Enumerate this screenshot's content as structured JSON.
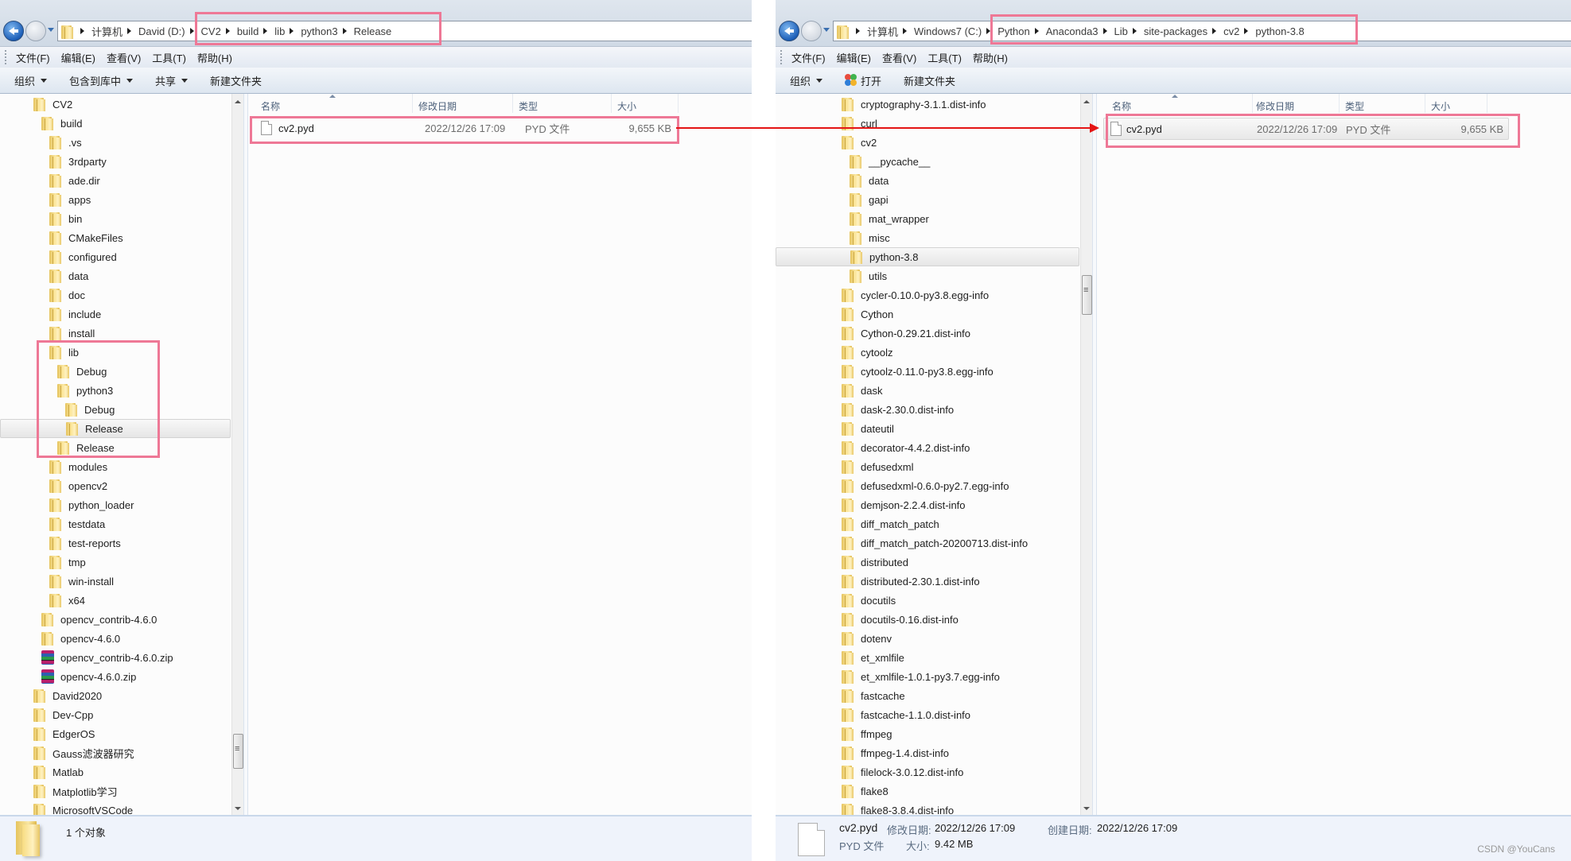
{
  "left_window": {
    "breadcrumb": [
      "计算机",
      "David (D:)",
      "CV2",
      "build",
      "lib",
      "python3",
      "Release"
    ],
    "menu": [
      "文件(F)",
      "编辑(E)",
      "查看(V)",
      "工具(T)",
      "帮助(H)"
    ],
    "toolbar": {
      "organize": "组织",
      "include_in_library": "包含到库中",
      "share": "共享",
      "new_folder": "新建文件夹"
    },
    "tree": [
      {
        "label": "CV2",
        "level": 0,
        "type": "folder"
      },
      {
        "label": "build",
        "level": 1,
        "type": "folder"
      },
      {
        "label": ".vs",
        "level": 2,
        "type": "folder"
      },
      {
        "label": "3rdparty",
        "level": 2,
        "type": "folder"
      },
      {
        "label": "ade.dir",
        "level": 2,
        "type": "folder"
      },
      {
        "label": "apps",
        "level": 2,
        "type": "folder"
      },
      {
        "label": "bin",
        "level": 2,
        "type": "folder"
      },
      {
        "label": "CMakeFiles",
        "level": 2,
        "type": "folder"
      },
      {
        "label": "configured",
        "level": 2,
        "type": "folder"
      },
      {
        "label": "data",
        "level": 2,
        "type": "folder"
      },
      {
        "label": "doc",
        "level": 2,
        "type": "folder"
      },
      {
        "label": "include",
        "level": 2,
        "type": "folder"
      },
      {
        "label": "install",
        "level": 2,
        "type": "folder"
      },
      {
        "label": "lib",
        "level": 2,
        "type": "folder"
      },
      {
        "label": "Debug",
        "level": 3,
        "type": "folder"
      },
      {
        "label": "python3",
        "level": 3,
        "type": "folder"
      },
      {
        "label": "Debug",
        "level": 4,
        "type": "folder"
      },
      {
        "label": "Release",
        "level": 4,
        "type": "folder",
        "selected": true
      },
      {
        "label": "Release",
        "level": 3,
        "type": "folder"
      },
      {
        "label": "modules",
        "level": 2,
        "type": "folder"
      },
      {
        "label": "opencv2",
        "level": 2,
        "type": "folder"
      },
      {
        "label": "python_loader",
        "level": 2,
        "type": "folder"
      },
      {
        "label": "testdata",
        "level": 2,
        "type": "folder"
      },
      {
        "label": "test-reports",
        "level": 2,
        "type": "folder"
      },
      {
        "label": "tmp",
        "level": 2,
        "type": "folder"
      },
      {
        "label": "win-install",
        "level": 2,
        "type": "folder"
      },
      {
        "label": "x64",
        "level": 2,
        "type": "folder"
      },
      {
        "label": "opencv_contrib-4.6.0",
        "level": 1,
        "type": "folder"
      },
      {
        "label": "opencv-4.6.0",
        "level": 1,
        "type": "folder"
      },
      {
        "label": "opencv_contrib-4.6.0.zip",
        "level": 1,
        "type": "zip"
      },
      {
        "label": "opencv-4.6.0.zip",
        "level": 1,
        "type": "zip"
      },
      {
        "label": "David2020",
        "level": 0,
        "type": "folder"
      },
      {
        "label": "Dev-Cpp",
        "level": 0,
        "type": "folder"
      },
      {
        "label": "EdgerOS",
        "level": 0,
        "type": "folder"
      },
      {
        "label": "Gauss滤波器研究",
        "level": 0,
        "type": "folder"
      },
      {
        "label": "Matlab",
        "level": 0,
        "type": "folder"
      },
      {
        "label": "Matplotlib学习",
        "level": 0,
        "type": "folder"
      },
      {
        "label": "MicrosoftVSCode",
        "level": 0,
        "type": "folder"
      }
    ],
    "columns": [
      "名称",
      "修改日期",
      "类型",
      "大小"
    ],
    "files": [
      {
        "name": "cv2.pyd",
        "modified": "2022/12/26 17:09",
        "type": "PYD 文件",
        "size": "9,655 KB"
      }
    ],
    "status": {
      "count_text": "1 个对象"
    }
  },
  "right_window": {
    "breadcrumb": [
      "计算机",
      "Windows7 (C:)",
      "Python",
      "Anaconda3",
      "Lib",
      "site-packages",
      "cv2",
      "python-3.8"
    ],
    "menu": [
      "文件(F)",
      "编辑(E)",
      "查看(V)",
      "工具(T)",
      "帮助(H)"
    ],
    "toolbar": {
      "organize": "组织",
      "open": "打开",
      "new_folder": "新建文件夹"
    },
    "tree": [
      {
        "label": "cryptography-3.1.1.dist-info",
        "level": 0
      },
      {
        "label": "curl",
        "level": 0
      },
      {
        "label": "cv2",
        "level": 0
      },
      {
        "label": "__pycache__",
        "level": 1
      },
      {
        "label": "data",
        "level": 1
      },
      {
        "label": "gapi",
        "level": 1
      },
      {
        "label": "mat_wrapper",
        "level": 1
      },
      {
        "label": "misc",
        "level": 1
      },
      {
        "label": "python-3.8",
        "level": 1,
        "selected": true
      },
      {
        "label": "utils",
        "level": 1
      },
      {
        "label": "cycler-0.10.0-py3.8.egg-info",
        "level": 0
      },
      {
        "label": "Cython",
        "level": 0
      },
      {
        "label": "Cython-0.29.21.dist-info",
        "level": 0
      },
      {
        "label": "cytoolz",
        "level": 0
      },
      {
        "label": "cytoolz-0.11.0-py3.8.egg-info",
        "level": 0
      },
      {
        "label": "dask",
        "level": 0
      },
      {
        "label": "dask-2.30.0.dist-info",
        "level": 0
      },
      {
        "label": "dateutil",
        "level": 0
      },
      {
        "label": "decorator-4.4.2.dist-info",
        "level": 0
      },
      {
        "label": "defusedxml",
        "level": 0
      },
      {
        "label": "defusedxml-0.6.0-py2.7.egg-info",
        "level": 0
      },
      {
        "label": "demjson-2.2.4.dist-info",
        "level": 0
      },
      {
        "label": "diff_match_patch",
        "level": 0
      },
      {
        "label": "diff_match_patch-20200713.dist-info",
        "level": 0
      },
      {
        "label": "distributed",
        "level": 0
      },
      {
        "label": "distributed-2.30.1.dist-info",
        "level": 0
      },
      {
        "label": "docutils",
        "level": 0
      },
      {
        "label": "docutils-0.16.dist-info",
        "level": 0
      },
      {
        "label": "dotenv",
        "level": 0
      },
      {
        "label": "et_xmlfile",
        "level": 0
      },
      {
        "label": "et_xmlfile-1.0.1-py3.7.egg-info",
        "level": 0
      },
      {
        "label": "fastcache",
        "level": 0
      },
      {
        "label": "fastcache-1.1.0.dist-info",
        "level": 0
      },
      {
        "label": "ffmpeg",
        "level": 0
      },
      {
        "label": "ffmpeg-1.4.dist-info",
        "level": 0
      },
      {
        "label": "filelock-3.0.12.dist-info",
        "level": 0
      },
      {
        "label": "flake8",
        "level": 0
      },
      {
        "label": "flake8-3.8.4.dist-info",
        "level": 0
      }
    ],
    "columns": [
      "名称",
      "修改日期",
      "类型",
      "大小"
    ],
    "files": [
      {
        "name": "cv2.pyd",
        "modified": "2022/12/26 17:09",
        "type": "PYD 文件",
        "size": "9,655 KB"
      }
    ],
    "status": {
      "name": "cv2.pyd",
      "modified_label": "修改日期:",
      "modified_value": "2022/12/26 17:09",
      "created_label": "创建日期:",
      "created_value": "2022/12/26 17:09",
      "type": "PYD 文件",
      "size_label": "大小:",
      "size_value": "9.42 MB"
    }
  },
  "annotation": {
    "highlight_color": "#ee7896",
    "arrow_color": "#e41414"
  },
  "watermark": "CSDN @YouCans"
}
